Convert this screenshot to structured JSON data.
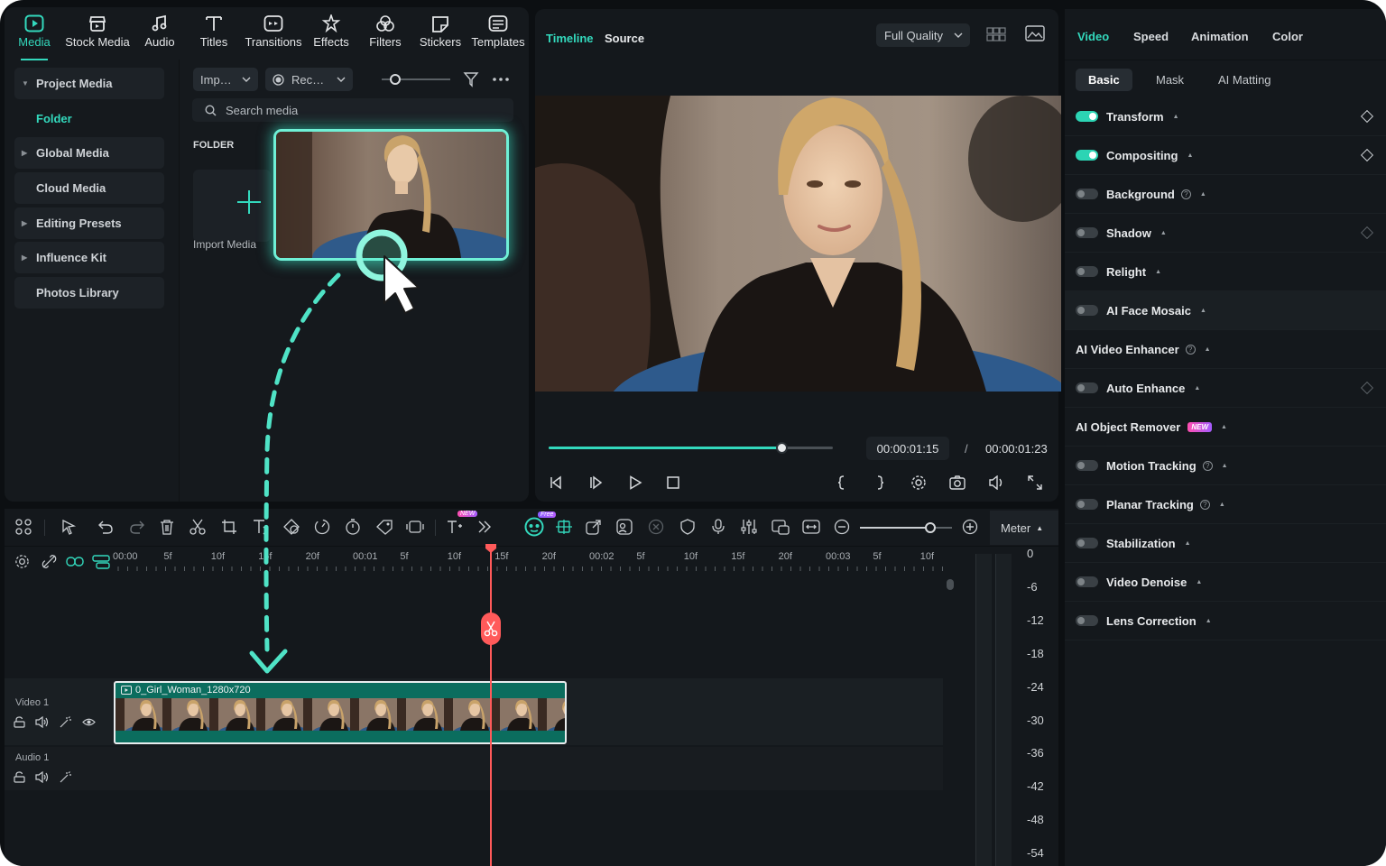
{
  "toolbar": {
    "tabs": [
      {
        "label": "Media",
        "icon": "media-icon",
        "active": true
      },
      {
        "label": "Stock Media",
        "icon": "stock-media-icon"
      },
      {
        "label": "Audio",
        "icon": "music-note-icon"
      },
      {
        "label": "Titles",
        "icon": "text-t-icon"
      },
      {
        "label": "Transitions",
        "icon": "transitions-icon"
      },
      {
        "label": "Effects",
        "icon": "effects-star-icon"
      },
      {
        "label": "Filters",
        "icon": "filters-icon"
      },
      {
        "label": "Stickers",
        "icon": "sticker-icon"
      },
      {
        "label": "Templates",
        "icon": "templates-icon"
      }
    ]
  },
  "sidebar": {
    "items": [
      {
        "label": "Project Media",
        "expanded": true
      },
      {
        "label": "Folder",
        "selected": true
      },
      {
        "label": "Global Media"
      },
      {
        "label": "Cloud Media"
      },
      {
        "label": "Editing Presets"
      },
      {
        "label": "Influence Kit"
      },
      {
        "label": "Photos Library"
      }
    ]
  },
  "media": {
    "import_dropdown": "Imp…",
    "record_dropdown": "Rec…",
    "zoom_level": 0.2,
    "search_placeholder": "Search media",
    "folder_title": "FOLDER",
    "import_label": "Import Media"
  },
  "preview": {
    "tab_timeline": "Timeline",
    "tab_source": "Source",
    "quality": "Full Quality",
    "progress": 0.82,
    "current_time": "00:00:01:15",
    "separator": "/",
    "total_time": "00:00:01:23"
  },
  "properties": {
    "tabs": [
      "Video",
      "Speed",
      "Animation",
      "Color"
    ],
    "sub_tabs": [
      "Basic",
      "Mask",
      "AI Matting"
    ],
    "rows": [
      {
        "label": "Transform",
        "toggle": true,
        "on": true,
        "keyframe": true
      },
      {
        "label": "Compositing",
        "toggle": true,
        "on": true,
        "keyframe": true
      },
      {
        "label": "Background",
        "toggle": true,
        "on": false,
        "help": true
      },
      {
        "label": "Shadow",
        "toggle": true,
        "on": false,
        "keyframe": true,
        "keyframe_dim": true
      },
      {
        "label": "Relight",
        "toggle": true,
        "on": false
      },
      {
        "label": "AI Face Mosaic",
        "toggle": true,
        "on": false,
        "highlight": true
      },
      {
        "label": "AI Video Enhancer",
        "toggle": false,
        "help": true
      },
      {
        "label": "Auto Enhance",
        "toggle": true,
        "on": false,
        "keyframe": true,
        "keyframe_dim": true
      },
      {
        "label": "AI Object Remover",
        "toggle": false,
        "badge": "NEW"
      },
      {
        "label": "Motion Tracking",
        "toggle": true,
        "on": false,
        "help": true
      },
      {
        "label": "Planar Tracking",
        "toggle": true,
        "on": false,
        "help": true
      },
      {
        "label": "Stabilization",
        "toggle": true,
        "on": false
      },
      {
        "label": "Video Denoise",
        "toggle": true,
        "on": false
      },
      {
        "label": "Lens Correction",
        "toggle": true,
        "on": false
      }
    ]
  },
  "timeline": {
    "meter_label": "Meter",
    "badge_new": "NEW",
    "badge_free": "Free",
    "ruler_labels": [
      "00:00",
      "5f",
      "10f",
      "15f",
      "20f",
      "00:01",
      "5f",
      "10f",
      "15f",
      "20f",
      "00:02",
      "5f",
      "10f",
      "15f",
      "20f",
      "00:03",
      "5f",
      "10f"
    ],
    "tracks": {
      "video_label": "Video 1",
      "audio_label": "Audio 1"
    },
    "clip_name": "0_Girl_Woman_1280x720",
    "meter_scale": [
      "0",
      "-6",
      "-12",
      "-18",
      "-24",
      "-30",
      "-36",
      "-42",
      "-48",
      "-54"
    ]
  },
  "colors": {
    "accent": "#33d9bd",
    "playhead": "#ff5a5a",
    "panel": "#14181c"
  }
}
